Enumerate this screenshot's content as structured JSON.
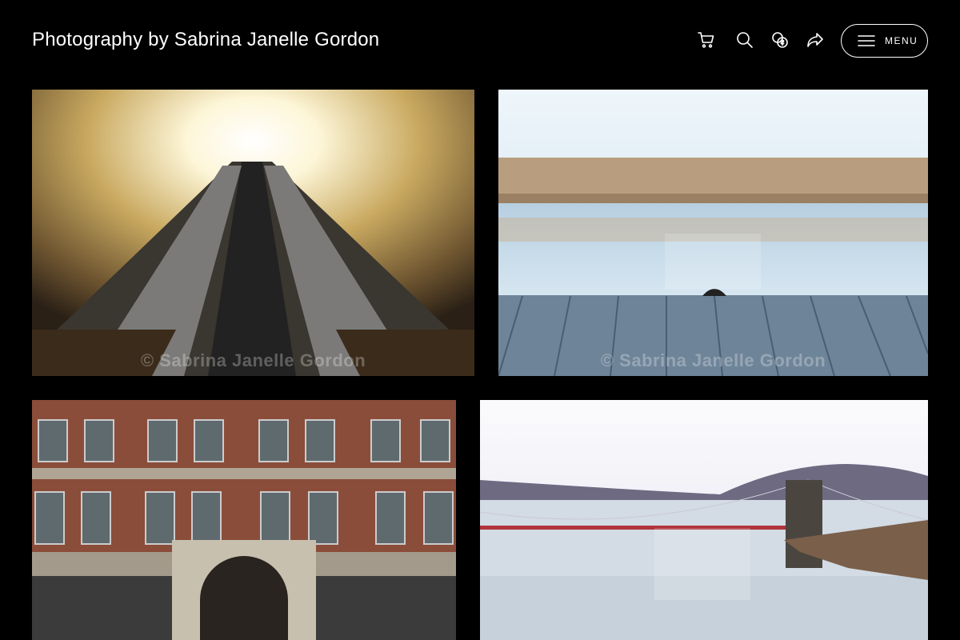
{
  "site": {
    "title": "Photography by Sabrina Janelle Gordon"
  },
  "header": {
    "icons": [
      "cart-icon",
      "search-icon",
      "currency-icon",
      "share-icon"
    ],
    "menu_label": "MENU"
  },
  "gallery": {
    "watermark": "© Sabrina Janelle Gordon",
    "photos": [
      {
        "subject": "escalator-tunnel"
      },
      {
        "subject": "river-town-reflection"
      },
      {
        "subject": "brick-building-facade"
      },
      {
        "subject": "suspension-bridge-river"
      }
    ]
  },
  "colors": {
    "background": "#000000",
    "text": "#ffffff"
  }
}
